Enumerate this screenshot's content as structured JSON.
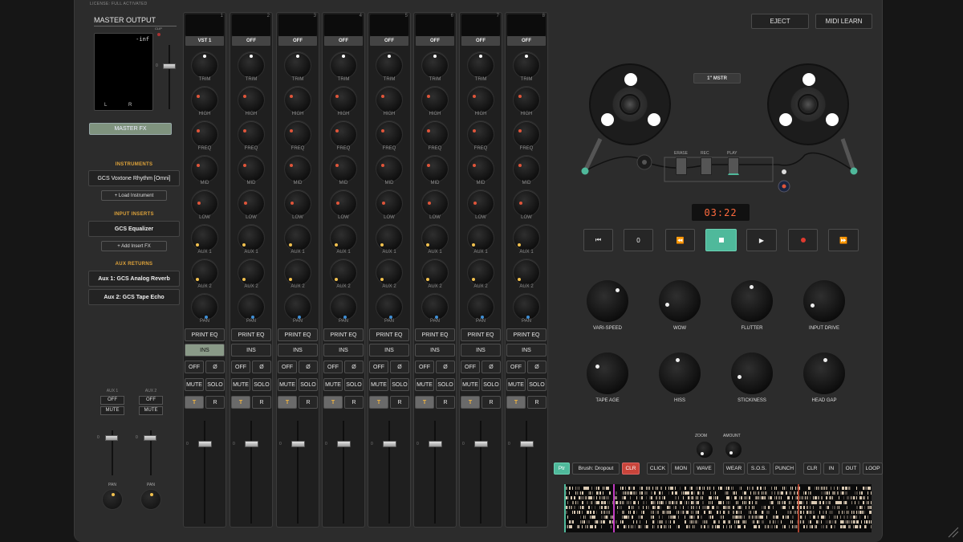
{
  "license": "LICENSE: FULL ACTIVATED",
  "master": {
    "title": "MASTER OUTPUT",
    "clip": "CLIP",
    "level": "-inf",
    "left": "L",
    "right": "R",
    "zero": "0",
    "fx_button": "MASTER FX"
  },
  "instruments": {
    "header": "INSTRUMENTS",
    "slot": "GCS Voxtone Rhythm [Omni]",
    "load": "+ Load Instrument"
  },
  "inserts": {
    "header": "INPUT INSERTS",
    "slot": "GCS Equalizer",
    "add": "+ Add Insert FX"
  },
  "aux_returns": {
    "header": "AUX RETURNS",
    "items": [
      "Aux 1: GCS Analog Reverb",
      "Aux 2: GCS Tape Echo"
    ]
  },
  "aux_channels": [
    {
      "label": "AUX 1",
      "off": "OFF",
      "mute": "MUTE",
      "zero": "0",
      "pan": "PAN"
    },
    {
      "label": "AUX 2",
      "off": "OFF",
      "mute": "MUTE",
      "zero": "0",
      "pan": "PAN"
    }
  ],
  "knob_labels": [
    "TRIM",
    "HIGH",
    "FREQ",
    "MID",
    "LOW",
    "AUX 1",
    "AUX 2",
    "PAN"
  ],
  "strip_buttons": {
    "print_eq": "PRINT EQ",
    "ins": "INS",
    "off": "OFF",
    "phase": "Ø",
    "mute": "MUTE",
    "solo": "SOLO",
    "t": "T",
    "r": "R",
    "zero": "0"
  },
  "channels": [
    {
      "number": "1",
      "input": "VST 1",
      "ins_active": true
    },
    {
      "number": "2",
      "input": "OFF",
      "ins_active": false
    },
    {
      "number": "3",
      "input": "OFF",
      "ins_active": false
    },
    {
      "number": "4",
      "input": "OFF",
      "ins_active": false
    },
    {
      "number": "5",
      "input": "OFF",
      "ins_active": false
    },
    {
      "number": "6",
      "input": "OFF",
      "ins_active": false
    },
    {
      "number": "7",
      "input": "OFF",
      "ins_active": false
    },
    {
      "number": "8",
      "input": "OFF",
      "ins_active": false
    }
  ],
  "tape": {
    "eject": "EJECT",
    "midi_learn": "MIDI LEARN",
    "badge": "1\" MSTR",
    "heads": [
      "ERASE",
      "REC",
      "PLAY"
    ],
    "time": "03:22",
    "transport": {
      "zero": "0"
    },
    "knobs_row1": [
      "VARI-SPEED",
      "WOW",
      "FLUTTER",
      "INPUT DRIVE"
    ],
    "knobs_row2": [
      "TAPE AGE",
      "HISS",
      "STICKINESS",
      "HEAD GAP"
    ],
    "zoom": "ZOOM",
    "amount": "AMOUNT",
    "edit_buttons": {
      "ptr": "Ptr",
      "brush": "Brush: Dropout",
      "clr": "CLR",
      "click": "CLICK",
      "mon": "MON",
      "wave": "WAVE",
      "wear": "WEAR",
      "sos": "S.O.S.",
      "punch": "PUNCH",
      "clr2": "CLR",
      "in": "IN",
      "out": "OUT",
      "loop": "LOOP"
    }
  },
  "colors": {
    "accent_teal": "#4fb99b",
    "clr_red": "#c9443a",
    "knob_gold": "#f2c14e",
    "knob_red": "#e0553a",
    "knob_blue": "#3f8fd6",
    "timer": "#ff6a3d"
  }
}
